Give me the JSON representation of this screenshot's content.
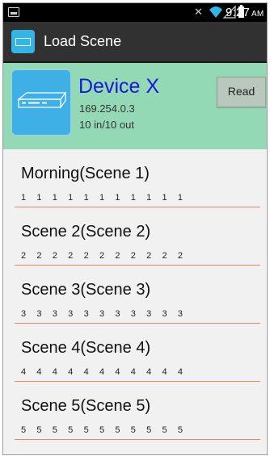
{
  "status_bar": {
    "time": "9:27",
    "ampm": "AM"
  },
  "app_bar": {
    "title": "Load Scene"
  },
  "device": {
    "name": "Device X",
    "ip": "169.254.0.3",
    "io": "10 in/10 out",
    "read_label": "Read",
    "header_color": "#93d9b5",
    "name_color": "#1818d8"
  },
  "scenes": [
    {
      "name": "Morning(Scene 1)",
      "values": [
        "1",
        "1",
        "1",
        "1",
        "1",
        "1",
        "1",
        "1",
        "1",
        "1",
        "1"
      ]
    },
    {
      "name": "Scene 2(Scene 2)",
      "values": [
        "2",
        "2",
        "2",
        "2",
        "2",
        "2",
        "2",
        "2",
        "2",
        "2",
        "2"
      ]
    },
    {
      "name": "Scene 3(Scene 3)",
      "values": [
        "3",
        "3",
        "3",
        "3",
        "3",
        "3",
        "3",
        "3",
        "3",
        "3",
        "3"
      ]
    },
    {
      "name": "Scene 4(Scene 4)",
      "values": [
        "4",
        "4",
        "4",
        "4",
        "4",
        "4",
        "4",
        "4",
        "4",
        "4",
        "4"
      ]
    },
    {
      "name": "Scene 5(Scene 5)",
      "values": [
        "5",
        "5",
        "5",
        "5",
        "5",
        "5",
        "5",
        "5",
        "5",
        "5",
        "5"
      ]
    }
  ]
}
